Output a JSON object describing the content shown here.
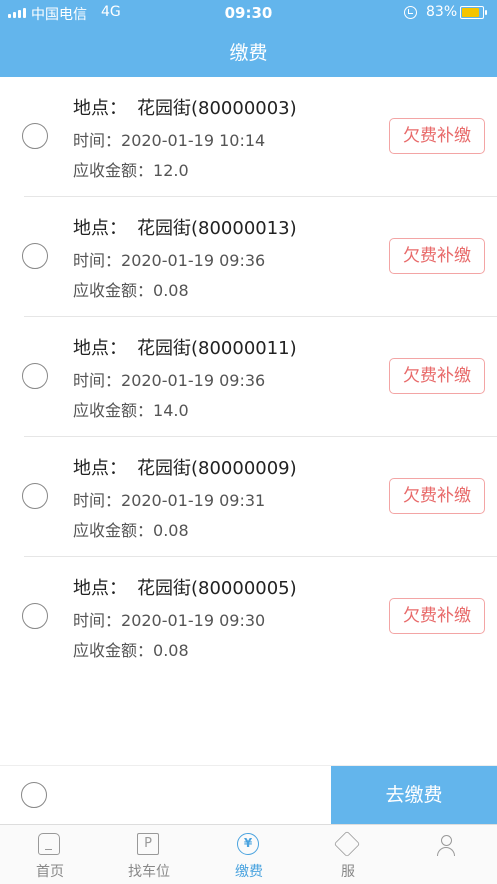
{
  "status_bar": {
    "carrier": "中国电信",
    "network": "4G",
    "time": "09:30",
    "battery": "83%",
    "battery_level": 0.83
  },
  "header": {
    "title": "缴费"
  },
  "records": [
    {
      "location_label": "地点：",
      "location": "花园街(80000003)",
      "time_label": "时间：",
      "time": "2020-01-19 10:14",
      "amount_label": "应收金额：",
      "amount": "12.0",
      "action": "欠费补缴"
    },
    {
      "location_label": "地点：",
      "location": "花园街(80000013)",
      "time_label": "时间：",
      "time": "2020-01-19 09:36",
      "amount_label": "应收金额：",
      "amount": "0.08",
      "action": "欠费补缴"
    },
    {
      "location_label": "地点：",
      "location": "花园街(80000011)",
      "time_label": "时间：",
      "time": "2020-01-19 09:36",
      "amount_label": "应收金额：",
      "amount": "14.0",
      "action": "欠费补缴"
    },
    {
      "location_label": "地点：",
      "location": "花园街(80000009)",
      "time_label": "时间：",
      "time": "2020-01-19 09:31",
      "amount_label": "应收金额：",
      "amount": "0.08",
      "action": "欠费补缴"
    },
    {
      "location_label": "地点：",
      "location": "花园街(80000005)",
      "time_label": "时间：",
      "time": "2020-01-19 09:30",
      "amount_label": "应收金额：",
      "amount": "0.08",
      "action": "欠费补缴"
    }
  ],
  "pay_bar": {
    "button": "去缴费"
  },
  "tabs": [
    {
      "label": "首页",
      "icon": "home-icon"
    },
    {
      "label": "找车位",
      "icon": "parking-icon"
    },
    {
      "label": "缴费",
      "icon": "yen-icon",
      "glyph": "¥"
    },
    {
      "label": "服",
      "icon": "box-icon"
    },
    {
      "label": "",
      "icon": "profile-icon"
    }
  ],
  "colors": {
    "accent": "#63b5ec",
    "warning_text": "#e86a6a",
    "warning_border": "#f3a5a5"
  }
}
